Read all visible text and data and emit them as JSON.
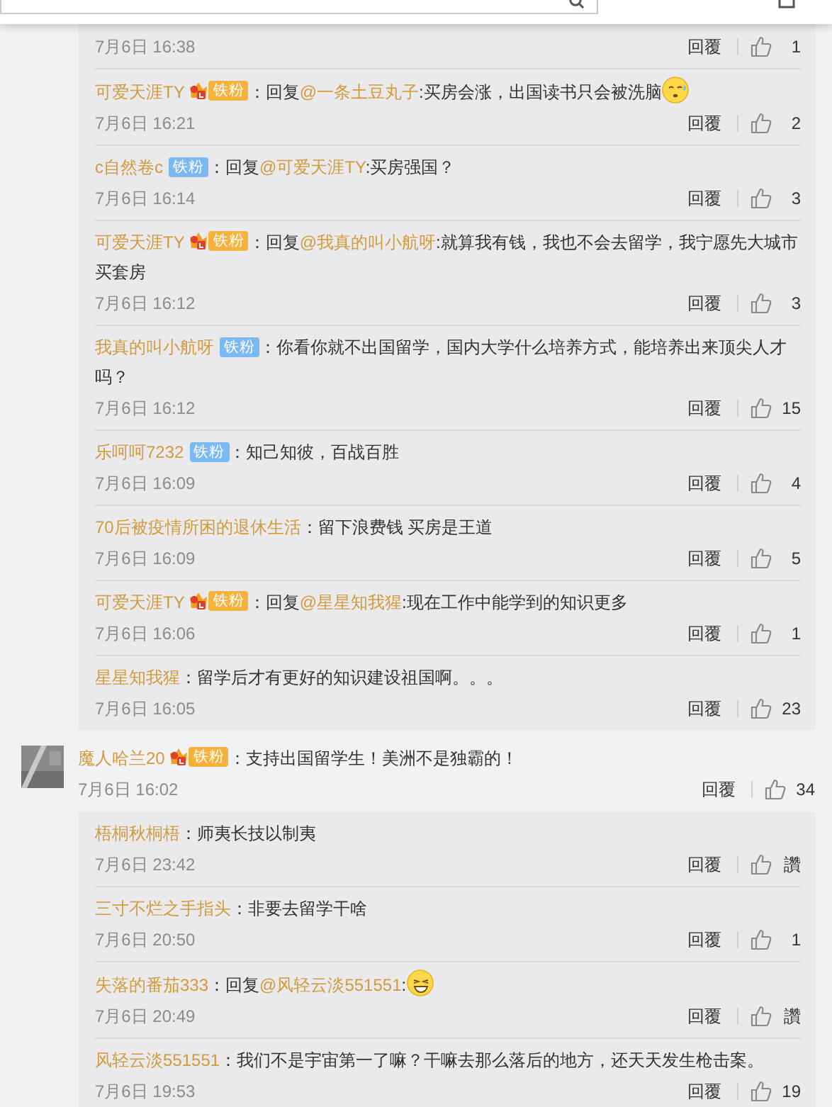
{
  "threads": [
    {
      "replies": [
        {
          "time": "7月6日 16:38",
          "reply_label": "回覆",
          "likes": "1"
        },
        {
          "user": "可爱天涯TY",
          "badge": {
            "kind": "crown",
            "label": "铁粉"
          },
          "parts": [
            {
              "kind": "plain",
              "text": "：回复"
            },
            {
              "kind": "mention",
              "text": "@一条土豆丸子"
            },
            {
              "kind": "plain",
              "text": ":买房会涨，出国读书只会被洗脑"
            },
            {
              "kind": "sweat"
            }
          ],
          "time": "7月6日 16:21",
          "reply_label": "回覆",
          "likes": "2"
        },
        {
          "user": "c自然卷c",
          "badge": {
            "kind": "plain",
            "label": "铁粉"
          },
          "parts": [
            {
              "kind": "plain",
              "text": "：回复"
            },
            {
              "kind": "mention",
              "text": "@可爱天涯TY"
            },
            {
              "kind": "plain",
              "text": ":买房强国？"
            }
          ],
          "time": "7月6日 16:14",
          "reply_label": "回覆",
          "likes": "3"
        },
        {
          "user": "可爱天涯TY",
          "badge": {
            "kind": "crown",
            "label": "铁粉"
          },
          "parts": [
            {
              "kind": "plain",
              "text": "：回复"
            },
            {
              "kind": "mention",
              "text": "@我真的叫小航呀"
            },
            {
              "kind": "plain",
              "text": ":就算我有钱，我也不会去留学，我宁愿先大城市买套房"
            }
          ],
          "time": "7月6日 16:12",
          "reply_label": "回覆",
          "likes": "3"
        },
        {
          "user": "我真的叫小航呀",
          "badge": {
            "kind": "plain",
            "label": "铁粉"
          },
          "parts": [
            {
              "kind": "plain",
              "text": "：你看你就不出国留学，国内大学什么培养方式，能培养出来顶尖人才吗？"
            }
          ],
          "time": "7月6日 16:12",
          "reply_label": "回覆",
          "likes": "15"
        },
        {
          "user": "乐呵呵7232",
          "badge": {
            "kind": "plain",
            "label": "铁粉"
          },
          "parts": [
            {
              "kind": "plain",
              "text": "：知己知彼，百战百胜"
            }
          ],
          "time": "7月6日 16:09",
          "reply_label": "回覆",
          "likes": "4"
        },
        {
          "user": "70后被疫情所困的退休生活",
          "parts": [
            {
              "kind": "plain",
              "text": "：留下浪费钱 买房是王道"
            }
          ],
          "time": "7月6日 16:09",
          "reply_label": "回覆",
          "likes": "5"
        },
        {
          "user": "可爱天涯TY",
          "badge": {
            "kind": "crown",
            "label": "铁粉"
          },
          "parts": [
            {
              "kind": "plain",
              "text": "：回复"
            },
            {
              "kind": "mention",
              "text": "@星星知我猩"
            },
            {
              "kind": "plain",
              "text": ":现在工作中能学到的知识更多"
            }
          ],
          "time": "7月6日 16:06",
          "reply_label": "回覆",
          "likes": "1"
        },
        {
          "user": "星星知我猩",
          "parts": [
            {
              "kind": "plain",
              "text": "：留学后才有更好的知识建设祖国啊。。。"
            }
          ],
          "time": "7月6日 16:05",
          "reply_label": "回覆",
          "likes": "23"
        }
      ]
    },
    {
      "comment": {
        "user": "魔人哈兰20",
        "badge": {
          "kind": "crown",
          "label": "铁粉"
        },
        "parts": [
          {
            "kind": "plain",
            "text": "：支持出国留学生！美洲不是独霸的！"
          }
        ],
        "time": "7月6日 16:02",
        "reply_label": "回覆",
        "likes": "34"
      },
      "replies": [
        {
          "user": "梧桐秋桐梧",
          "parts": [
            {
              "kind": "plain",
              "text": "：师夷长技以制夷"
            }
          ],
          "time": "7月6日 23:42",
          "reply_label": "回覆",
          "likes": "讚"
        },
        {
          "user": "三寸不烂之手指头",
          "parts": [
            {
              "kind": "plain",
              "text": "：非要去留学干啥"
            }
          ],
          "time": "7月6日 20:50",
          "reply_label": "回覆",
          "likes": "1"
        },
        {
          "user": "失落的番茄333",
          "parts": [
            {
              "kind": "plain",
              "text": "：回复"
            },
            {
              "kind": "mention",
              "text": "@风轻云淡551551"
            },
            {
              "kind": "plain",
              "text": ":"
            },
            {
              "kind": "grin"
            }
          ],
          "time": "7月6日 20:49",
          "reply_label": "回覆",
          "likes": "讚"
        },
        {
          "user": "风轻云淡551551",
          "parts": [
            {
              "kind": "plain",
              "text": "：我们不是宇宙第一了嘛？干嘛去那么落后的地方，还天天发生枪击案。"
            }
          ],
          "time": "7月6日 19:53",
          "reply_label": "回覆",
          "likes": "19"
        }
      ]
    }
  ]
}
